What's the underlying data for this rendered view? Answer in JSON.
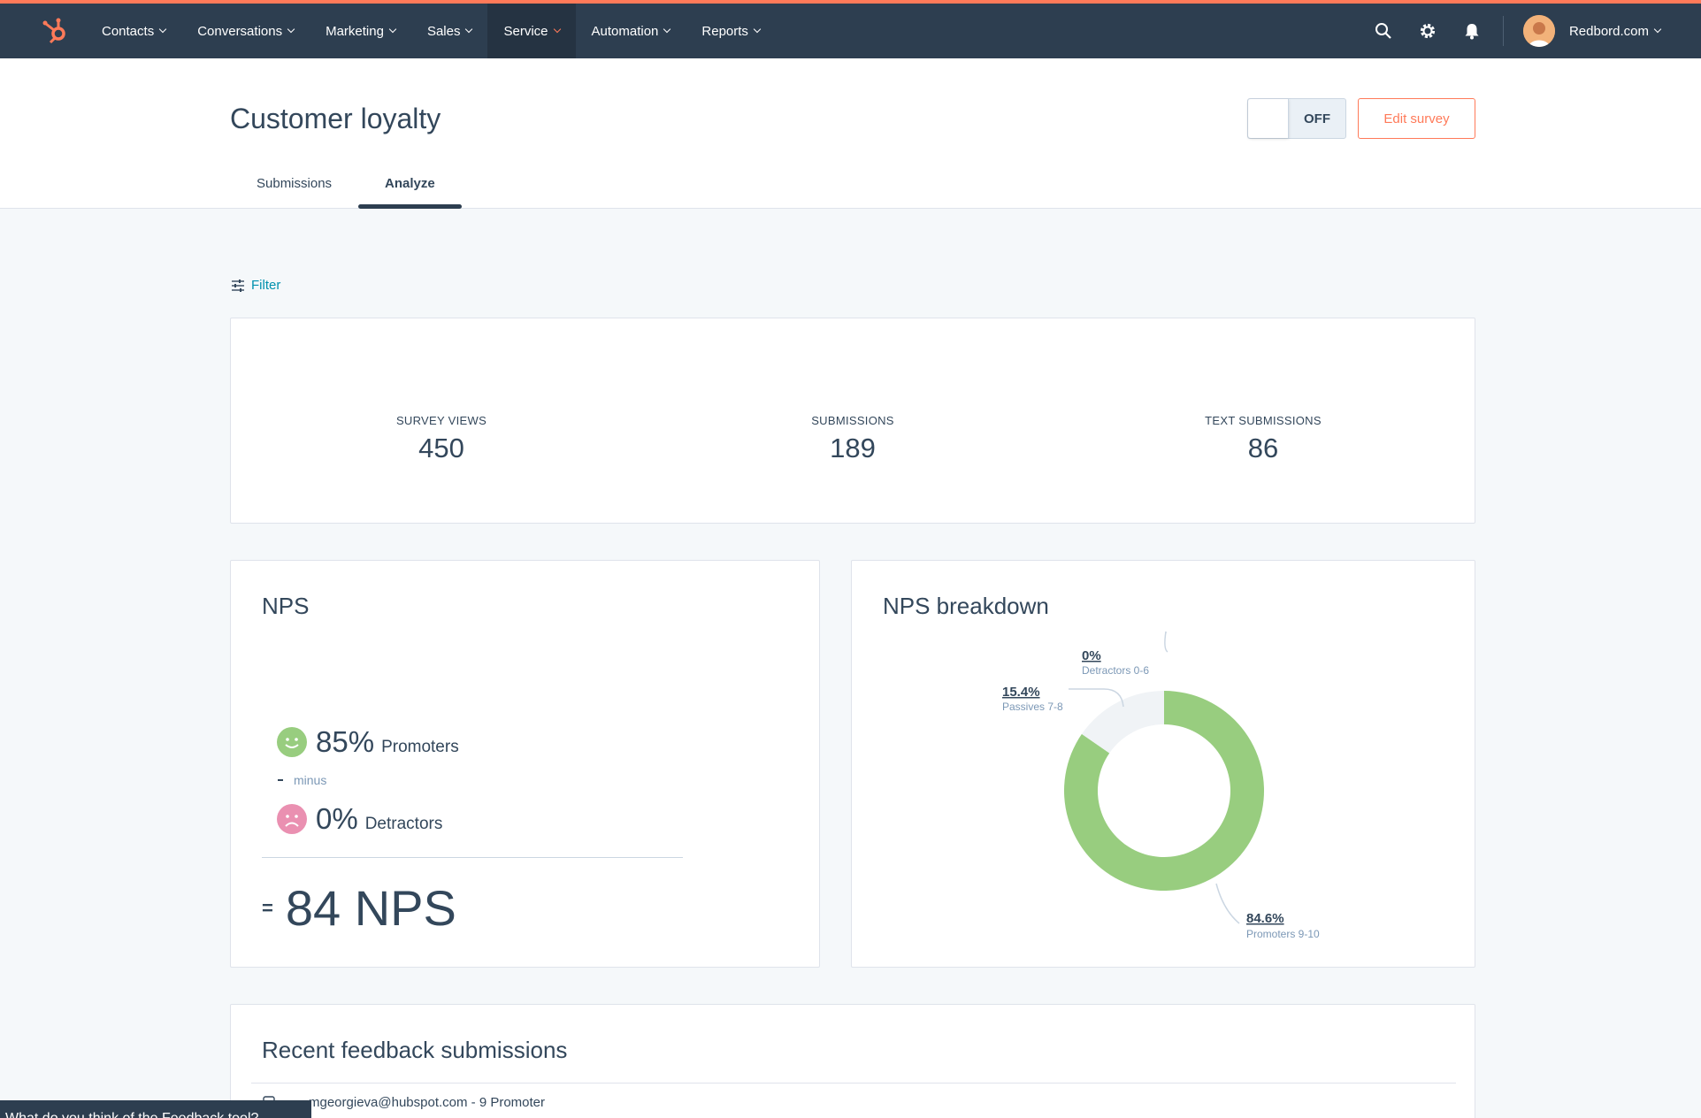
{
  "nav": {
    "items": [
      {
        "label": "Contacts",
        "active": false
      },
      {
        "label": "Conversations",
        "active": false
      },
      {
        "label": "Marketing",
        "active": false
      },
      {
        "label": "Sales",
        "active": false
      },
      {
        "label": "Service",
        "active": true
      },
      {
        "label": "Automation",
        "active": false
      },
      {
        "label": "Reports",
        "active": false
      }
    ],
    "account_label": "Redbord.com",
    "icons": [
      "sprocket-logo-icon",
      "search-icon",
      "gear-icon",
      "bell-icon"
    ],
    "accent_color": "#ff7a59"
  },
  "header": {
    "title": "Customer loyalty",
    "toggle_label": "OFF",
    "edit_label": "Edit survey",
    "tabs": [
      {
        "label": "Submissions",
        "active": false
      },
      {
        "label": "Analyze",
        "active": true
      }
    ]
  },
  "filter": {
    "label": "Filter"
  },
  "stats": [
    {
      "label": "SURVEY VIEWS",
      "value": "450"
    },
    {
      "label": "SUBMISSIONS",
      "value": "189"
    },
    {
      "label": "TEXT SUBMISSIONS",
      "value": "86"
    }
  ],
  "nps": {
    "title": "NPS",
    "promoters_pct": "85%",
    "promoters_label": "Promoters",
    "minus_label": "minus",
    "detractors_pct": "0%",
    "detractors_label": "Detractors",
    "equals": "=",
    "score": "84 NPS",
    "promoter_color": "#98cd7f",
    "detractor_color": "#ea90b1"
  },
  "breakdown": {
    "title": "NPS breakdown",
    "labels": [
      {
        "pct": "0%",
        "name": "Detractors 0-6"
      },
      {
        "pct": "15.4%",
        "name": "Passives 7-8"
      },
      {
        "pct": "84.6%",
        "name": "Promoters 9-10"
      }
    ]
  },
  "chart_data": {
    "type": "pie",
    "title": "NPS breakdown",
    "categories": [
      "Detractors 0-6",
      "Passives 7-8",
      "Promoters 9-10"
    ],
    "values": [
      0,
      15.4,
      84.6
    ],
    "colors": [
      "#f5c26b",
      "#f0f3f6",
      "#98cd7f"
    ]
  },
  "feedback": {
    "title": "Recent feedback submissions",
    "row_email": "mgeorgieva@hubspot.com",
    "row_score": " - 9 Promoter"
  },
  "feedback_tab": {
    "label": "What do you think of the Feedback tool?"
  }
}
